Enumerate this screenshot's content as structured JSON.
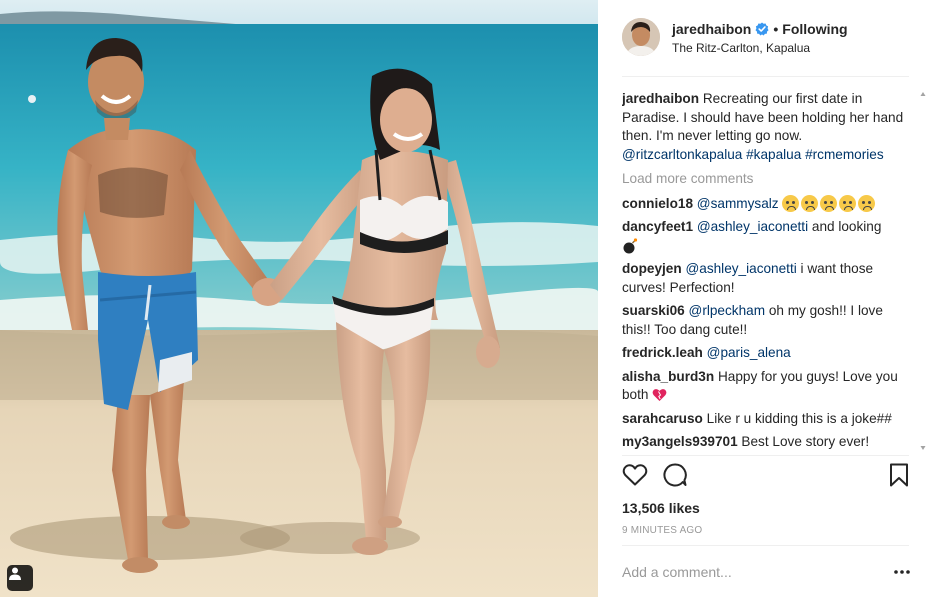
{
  "post": {
    "username": "jaredhaibon",
    "verified": true,
    "separator": "•",
    "follow_label": "Following",
    "location": "The Ritz-Carlton, Kapalua",
    "caption": {
      "author": "jaredhaibon",
      "text": "Recreating our first date in Paradise. I should have been holding her hand then. I'm never letting go now.",
      "tags": "@ritzcarltonkapalua #kapalua #rcmemories"
    },
    "load_more_label": "Load more comments",
    "comments": [
      {
        "user": "connielo18",
        "mention": "@sammysalz",
        "text": "",
        "emoji": "crying-face-emoji x5"
      },
      {
        "user": "dancyfeet1",
        "mention": "@ashley_iaconetti",
        "text": "and looking",
        "emoji": "bomb-emoji"
      },
      {
        "user": "dopeyjen",
        "mention": "@ashley_iaconetti",
        "text": "i want those curves! Perfection!",
        "emoji": ""
      },
      {
        "user": "suarski06",
        "mention": "@rlpeckham",
        "text": "oh my gosh!! I love this!! Too dang cute!!",
        "emoji": ""
      },
      {
        "user": "fredrick.leah",
        "mention": "@paris_alena",
        "text": "",
        "emoji": ""
      },
      {
        "user": "alisha_burd3n",
        "mention": "",
        "text": "Happy for you guys! Love you both",
        "emoji": "heart-emoji"
      },
      {
        "user": "sarahcaruso",
        "mention": "",
        "text": "Like r u kidding this is a joke##",
        "emoji": ""
      },
      {
        "user": "my3angels939701",
        "mention": "",
        "text": "Best Love story ever!",
        "emoji": ""
      }
    ],
    "likes_label": "13,506 likes",
    "time_label": "9 MINUTES AGO",
    "comment_placeholder": "Add a comment..."
  },
  "icons": {
    "like": "heart-outline-icon",
    "comment": "speech-bubble-icon",
    "save": "bookmark-icon",
    "more": "ellipsis-icon",
    "tagged": "tagged-user-icon",
    "verified": "verified-badge-icon"
  },
  "colors": {
    "link": "#003569",
    "verified_blue": "#3897f0",
    "muted": "#999999",
    "text": "#262626"
  }
}
